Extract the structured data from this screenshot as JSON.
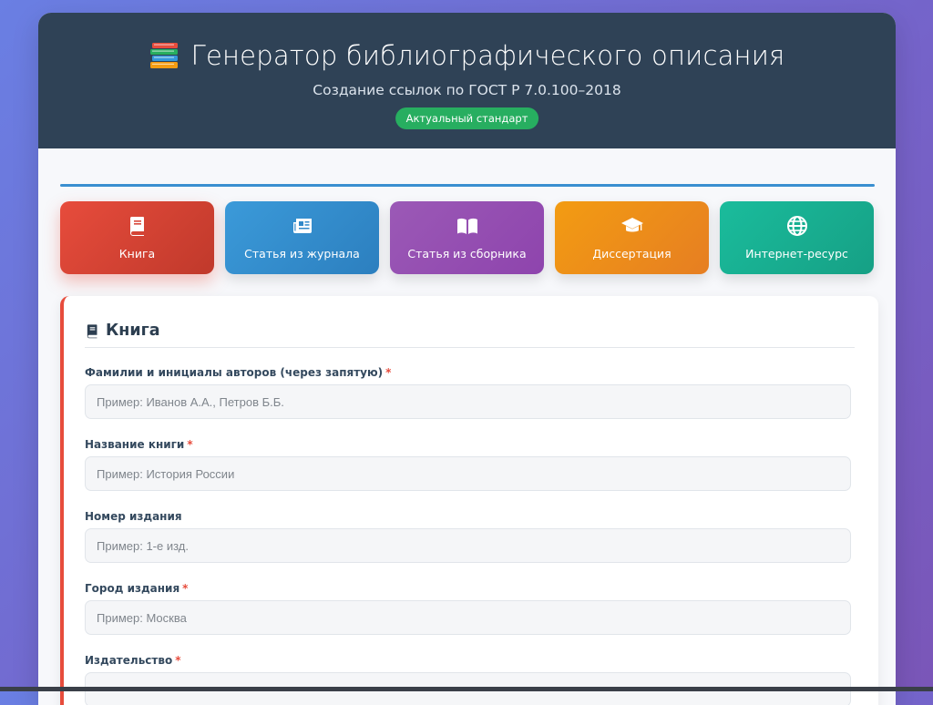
{
  "header": {
    "title": "Генератор библиографического описания",
    "subtitle": "Создание ссылок по ГОСТ Р 7.0.100–2018",
    "badge": "Актуальный стандарт",
    "icon": "books-icon"
  },
  "types": [
    {
      "label": "Книга",
      "icon": "book-icon",
      "color": "#e74c3c"
    },
    {
      "label": "Статья из журнала",
      "icon": "newspaper-icon",
      "color": "#3498db"
    },
    {
      "label": "Статья из сборника",
      "icon": "open-book-icon",
      "color": "#9b59b6"
    },
    {
      "label": "Диссертация",
      "icon": "graduation-cap-icon",
      "color": "#f39c12"
    },
    {
      "label": "Интернет-ресурс",
      "icon": "globe-icon",
      "color": "#1abc9c"
    }
  ],
  "form": {
    "title": "Книга",
    "fields": [
      {
        "label": "Фамилии и инициалы авторов (через запятую)",
        "required": "*",
        "placeholder": "Пример: Иванов А.А., Петров Б.Б.",
        "value": ""
      },
      {
        "label": "Название книги",
        "required": "*",
        "placeholder": "Пример: История России",
        "value": ""
      },
      {
        "label": "Номер издания",
        "required": "",
        "placeholder": "Пример: 1-е изд.",
        "value": ""
      },
      {
        "label": "Город издания",
        "required": "*",
        "placeholder": "Пример: Москва",
        "value": ""
      },
      {
        "label": "Издательство",
        "required": "*",
        "placeholder": "",
        "value": ""
      }
    ]
  },
  "colors": {
    "header_bg": "#2f4256",
    "accent": "#3a8fd0",
    "badge": "#27ae60",
    "required": "#e74c3c"
  }
}
